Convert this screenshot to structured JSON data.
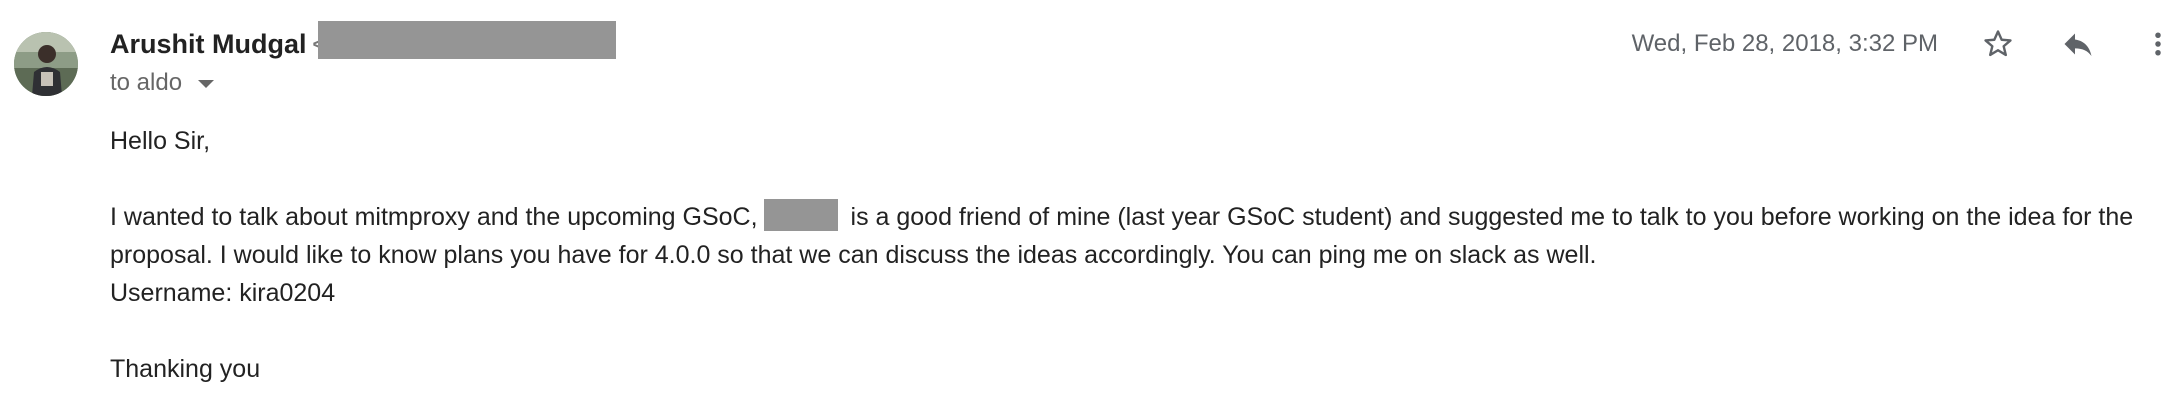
{
  "sender": {
    "name": "Arushit Mudgal",
    "email_prefix": "<",
    "avatar_icon": "avatar-photo"
  },
  "recipient": {
    "to_line": "to aldo"
  },
  "meta": {
    "date": "Wed, Feb 28, 2018, 3:32 PM"
  },
  "actions": {
    "star_icon": "star-icon",
    "reply_icon": "reply-icon",
    "more_icon": "more-vert-icon"
  },
  "body": {
    "greeting": "Hello Sir,",
    "para1_before": "I wanted to talk about mitmproxy and the upcoming GSoC,",
    "para1_after": " is a good friend of mine (last year GSoC student) and suggested me to talk to you before working on the idea for the proposal. I would like to know plans you have for 4.0.0 so that we can discuss the ideas accordingly. You can ping me on slack as well.",
    "username_line": "Username: kira0204",
    "closing": "Thanking you"
  },
  "colors": {
    "redaction": "#959595",
    "text": "#222222",
    "muted": "#5f6368"
  }
}
